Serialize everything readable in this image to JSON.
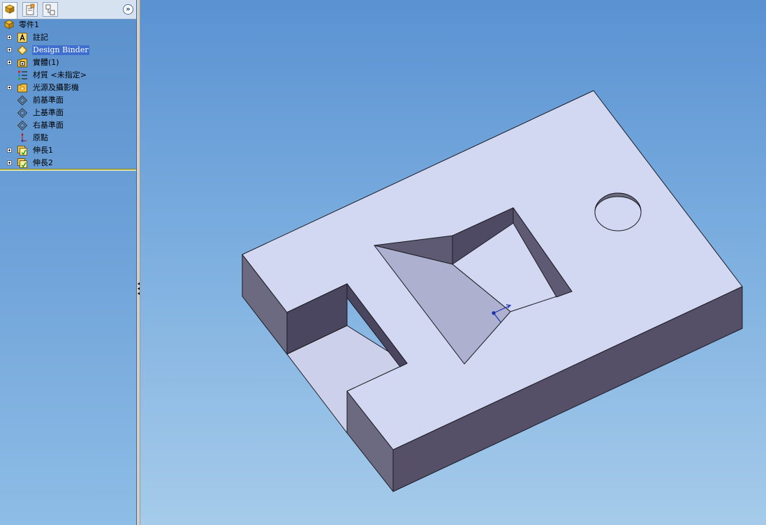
{
  "feature_tree": {
    "tabs": [
      "featuremanager-tab",
      "propertymanager-tab",
      "configurationmanager-tab"
    ],
    "root_label": "零件1",
    "items": [
      {
        "label": "註記",
        "icon": "annotations-icon",
        "expandable": true
      },
      {
        "label": "Design Binder",
        "icon": "design-binder-icon",
        "expandable": true,
        "selected": true
      },
      {
        "label": "實體(1)",
        "icon": "solid-bodies-icon",
        "expandable": true
      },
      {
        "label": "材質 <未指定>",
        "icon": "material-icon",
        "expandable": false
      },
      {
        "label": "光源及攝影機",
        "icon": "lights-cameras-icon",
        "expandable": true
      },
      {
        "label": "前基準面",
        "icon": "plane-icon",
        "expandable": false
      },
      {
        "label": "上基準面",
        "icon": "plane-icon",
        "expandable": false
      },
      {
        "label": "右基準面",
        "icon": "plane-icon",
        "expandable": false
      },
      {
        "label": "原點",
        "icon": "origin-icon",
        "expandable": false
      },
      {
        "label": "伸長1",
        "icon": "extrude-icon",
        "expandable": true
      },
      {
        "label": "伸長2",
        "icon": "extrude-icon",
        "expandable": true
      }
    ]
  },
  "viewport": {
    "model": "block-part-with-slot-pocket-and-hole",
    "colors": {
      "top_face": "#d3d8f2",
      "side_face_dark": "#555068",
      "side_face_mid": "#6c6a80",
      "pocket_wall": "#aeb0d0",
      "edge": "#1a1a22",
      "background_top": "#5a92d2",
      "background_bottom": "#a6cbea",
      "selection": "#3d6ed0"
    }
  }
}
